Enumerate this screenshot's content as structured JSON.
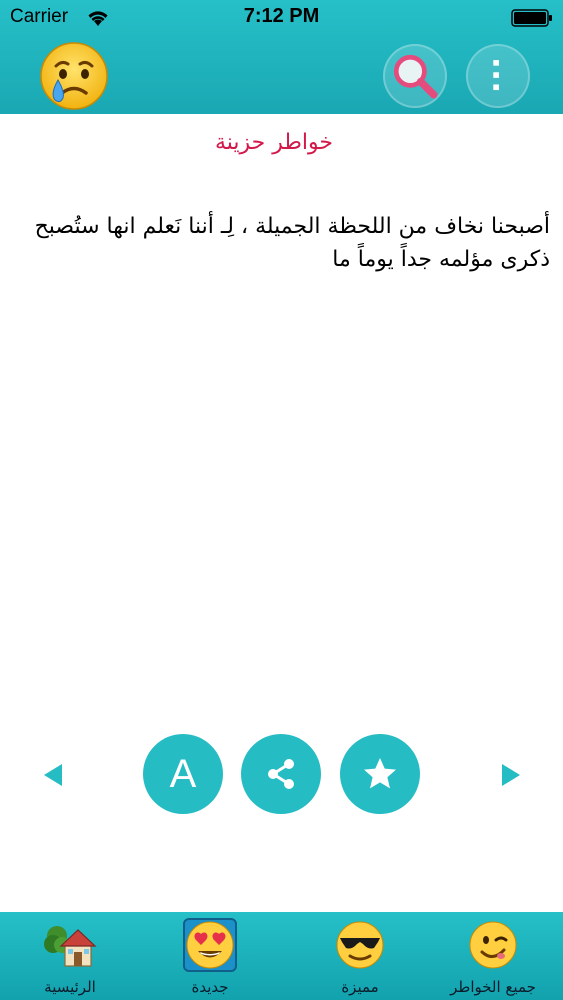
{
  "status_bar": {
    "carrier": "Carrier",
    "time": "7:12 PM",
    "icons": [
      "wifi-icon",
      "battery-icon"
    ]
  },
  "nav": {
    "left_icon": "crying-face-icon",
    "right_icons": [
      "search-icon",
      "more-vertical-icon"
    ]
  },
  "content": {
    "title": "خواطر حزينة",
    "text": "أصبحنا نخاف من اللحظة الجميلة ، لِـ أننا نَعلم انها ستُصبح ذكرى مؤلمه جداً يوماً ما"
  },
  "actions": {
    "font_label": "A",
    "icons": [
      "previous-arrow-icon",
      "font-size-icon",
      "share-icon",
      "star-icon",
      "next-arrow-icon"
    ]
  },
  "tabs": [
    {
      "label": "الرئيسية",
      "icon": "house-icon"
    },
    {
      "label": "جديدة",
      "icon": "heart-eyes-icon",
      "selected": true
    },
    {
      "label": "مميزة",
      "icon": "sunglasses-face-icon"
    },
    {
      "label": "جميع الخواطر",
      "icon": "winking-face-icon"
    }
  ],
  "colors": {
    "brand": "#1fb4bd",
    "title": "#d3194a",
    "action_button": "#25bcc4"
  }
}
